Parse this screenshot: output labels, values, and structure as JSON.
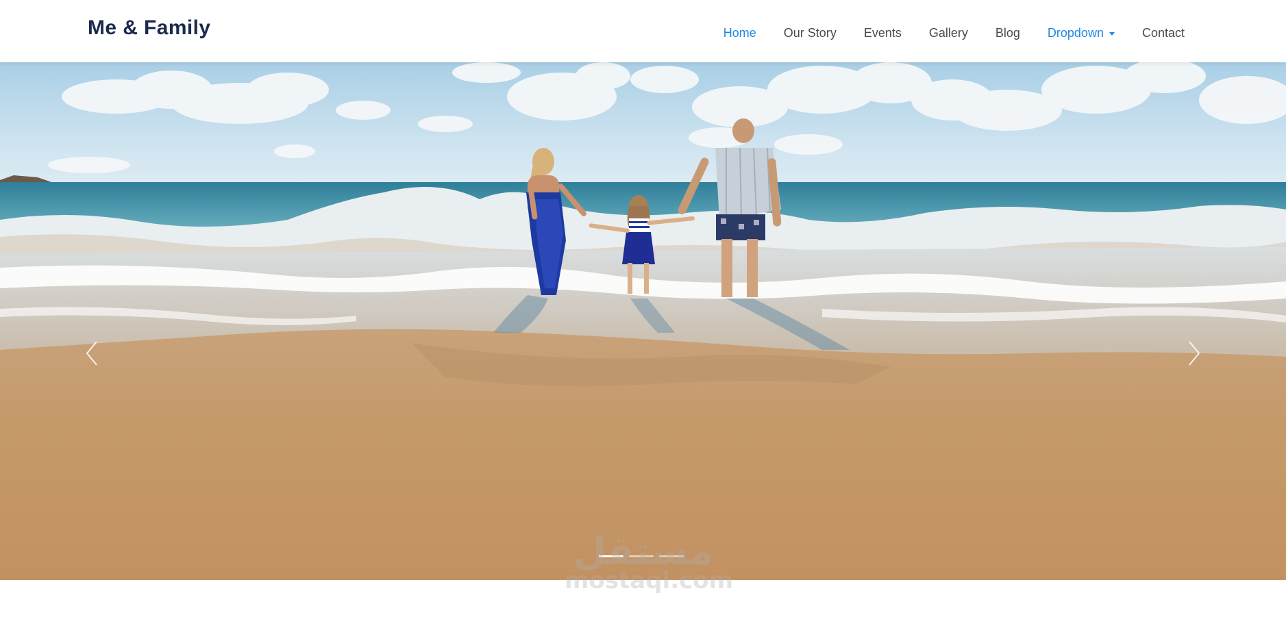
{
  "brand": {
    "title": "Me & Family"
  },
  "nav": {
    "items": [
      {
        "label": "Home"
      },
      {
        "label": "Our Story"
      },
      {
        "label": "Events"
      },
      {
        "label": "Gallery"
      },
      {
        "label": "Blog"
      },
      {
        "label": "Dropdown"
      },
      {
        "label": "Contact"
      }
    ],
    "active_item": "Home",
    "accent_color": "#1e88e5",
    "text_color": "#4a4a4a",
    "brand_color": "#1b2a4e"
  },
  "hero": {
    "image": "family-at-beach-photo",
    "prev_icon": "chevron-left-icon",
    "next_icon": "chevron-right-icon",
    "slides": 3,
    "active_slide": 1
  },
  "watermark": {
    "arabic": "مستقل",
    "latin": "mostaql.com"
  }
}
